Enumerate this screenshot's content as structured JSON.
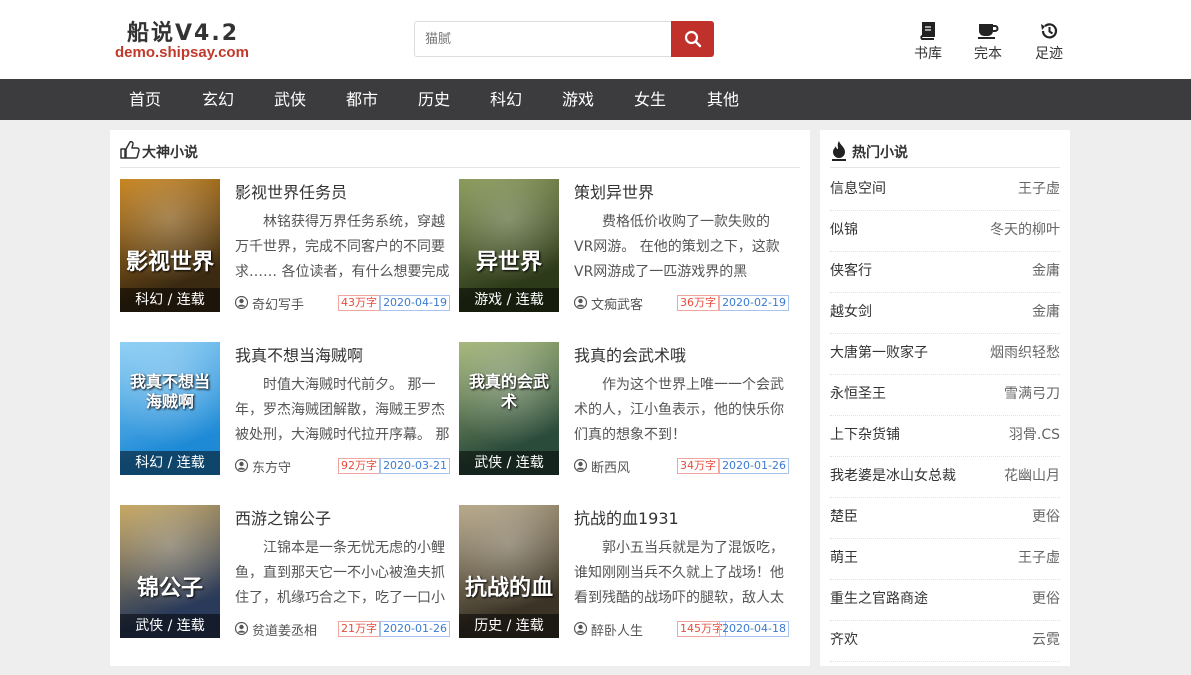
{
  "header": {
    "logo_title": "船说V4.2",
    "logo_url": "demo.shipsay.com",
    "search_placeholder": "猫腻",
    "nav": [
      {
        "label": "书库",
        "icon": "book-icon"
      },
      {
        "label": "完本",
        "icon": "cup-icon"
      },
      {
        "label": "足迹",
        "icon": "history-icon"
      }
    ]
  },
  "mainnav": [
    "首页",
    "玄幻",
    "武侠",
    "都市",
    "历史",
    "科幻",
    "游戏",
    "女生",
    "其他"
  ],
  "left_panel": {
    "title": "大神小说",
    "icon": "thumbs-up-icon",
    "books": [
      {
        "title": "影视世界任务员",
        "tag": "科幻 / 连载",
        "cover_text": "影视世界",
        "desc": "林铭获得万界任务系统，穿越万千世界，完成不同客户的不同要求…… 各位读者，有什么想要完成",
        "author": "奇幻写手",
        "words": "43万字",
        "date": "2020-04-19",
        "colors": [
          "#3b2a12",
          "#c9851f"
        ]
      },
      {
        "title": "策划异世界",
        "tag": "游戏 / 连载",
        "cover_text": "异世界",
        "desc": "费格低价收购了一款失败的VR网游。 在他的策划之下，这款VR网游成了一匹游戏界的黑马…… 毕",
        "author": "文痴武客",
        "words": "36万字",
        "date": "2020-02-19",
        "colors": [
          "#2d3a1a",
          "#8a9b5a"
        ]
      },
      {
        "title": "我真不想当海贼啊",
        "tag": "科幻 / 连载",
        "cover_text": "我真不想当海贼啊",
        "desc": "时值大海贼时代前夕。 那一年，罗杰海贼团解散，海贼王罗杰被处刑，大海贼时代拉开序幕。 那",
        "author": "东方守",
        "words": "92万字",
        "date": "2020-03-21",
        "colors": [
          "#1e8ad6",
          "#8fd0f5"
        ]
      },
      {
        "title": "我真的会武术哦",
        "tag": "武侠 / 连载",
        "cover_text": "我真的会武术",
        "desc": "作为这个世界上唯一一个会武术的人，江小鱼表示，他的快乐你们真的想象不到！",
        "author": "断西风",
        "words": "34万字",
        "date": "2020-01-26",
        "colors": [
          "#2a4a3a",
          "#a6b87a"
        ]
      },
      {
        "title": "西游之锦公子",
        "tag": "武侠 / 连载",
        "cover_text": "锦公子",
        "desc": "江锦本是一条无忧无虑的小鲤鱼，直到那天它一不小心被渔夫抓住了，机缘巧合之下，吃了一口小",
        "author": "贫道姜丞相",
        "words": "21万字",
        "date": "2020-01-26",
        "colors": [
          "#2a3a5a",
          "#c8a860"
        ]
      },
      {
        "title": "抗战的血1931",
        "tag": "历史 / 连载",
        "cover_text": "抗战的血",
        "desc": "郭小五当兵就是为了混饭吃，谁知刚刚当兵不久就上了战场！他看到残酷的战场吓的腿软，敌人太",
        "author": "醉卧人生",
        "words": "145万字",
        "date": "2020-04-18",
        "colors": [
          "#3a3326",
          "#b8a98a"
        ]
      }
    ]
  },
  "right_panel": {
    "title": "热门小说",
    "icon": "fire-icon",
    "items": [
      {
        "name": "信息空间",
        "author": "王子虚"
      },
      {
        "name": "似锦",
        "author": "冬天的柳叶"
      },
      {
        "name": "侠客行",
        "author": "金庸"
      },
      {
        "name": "越女剑",
        "author": "金庸"
      },
      {
        "name": "大唐第一败家子",
        "author": "烟雨织轻愁"
      },
      {
        "name": "永恒圣王",
        "author": "雪满弓刀"
      },
      {
        "name": "上下杂货铺",
        "author": "羽骨.CS"
      },
      {
        "name": "我老婆是冰山女总裁",
        "author": "花幽山月"
      },
      {
        "name": "楚臣",
        "author": "更俗"
      },
      {
        "name": "萌王",
        "author": "王子虚"
      },
      {
        "name": "重生之官路商途",
        "author": "更俗"
      },
      {
        "name": "齐欢",
        "author": "云霓"
      }
    ]
  },
  "colors": {
    "accent": "#c0312b",
    "nav_bg": "#3c3c3e",
    "words_red": "#e74c3c",
    "date_blue": "#3a7bd5"
  }
}
